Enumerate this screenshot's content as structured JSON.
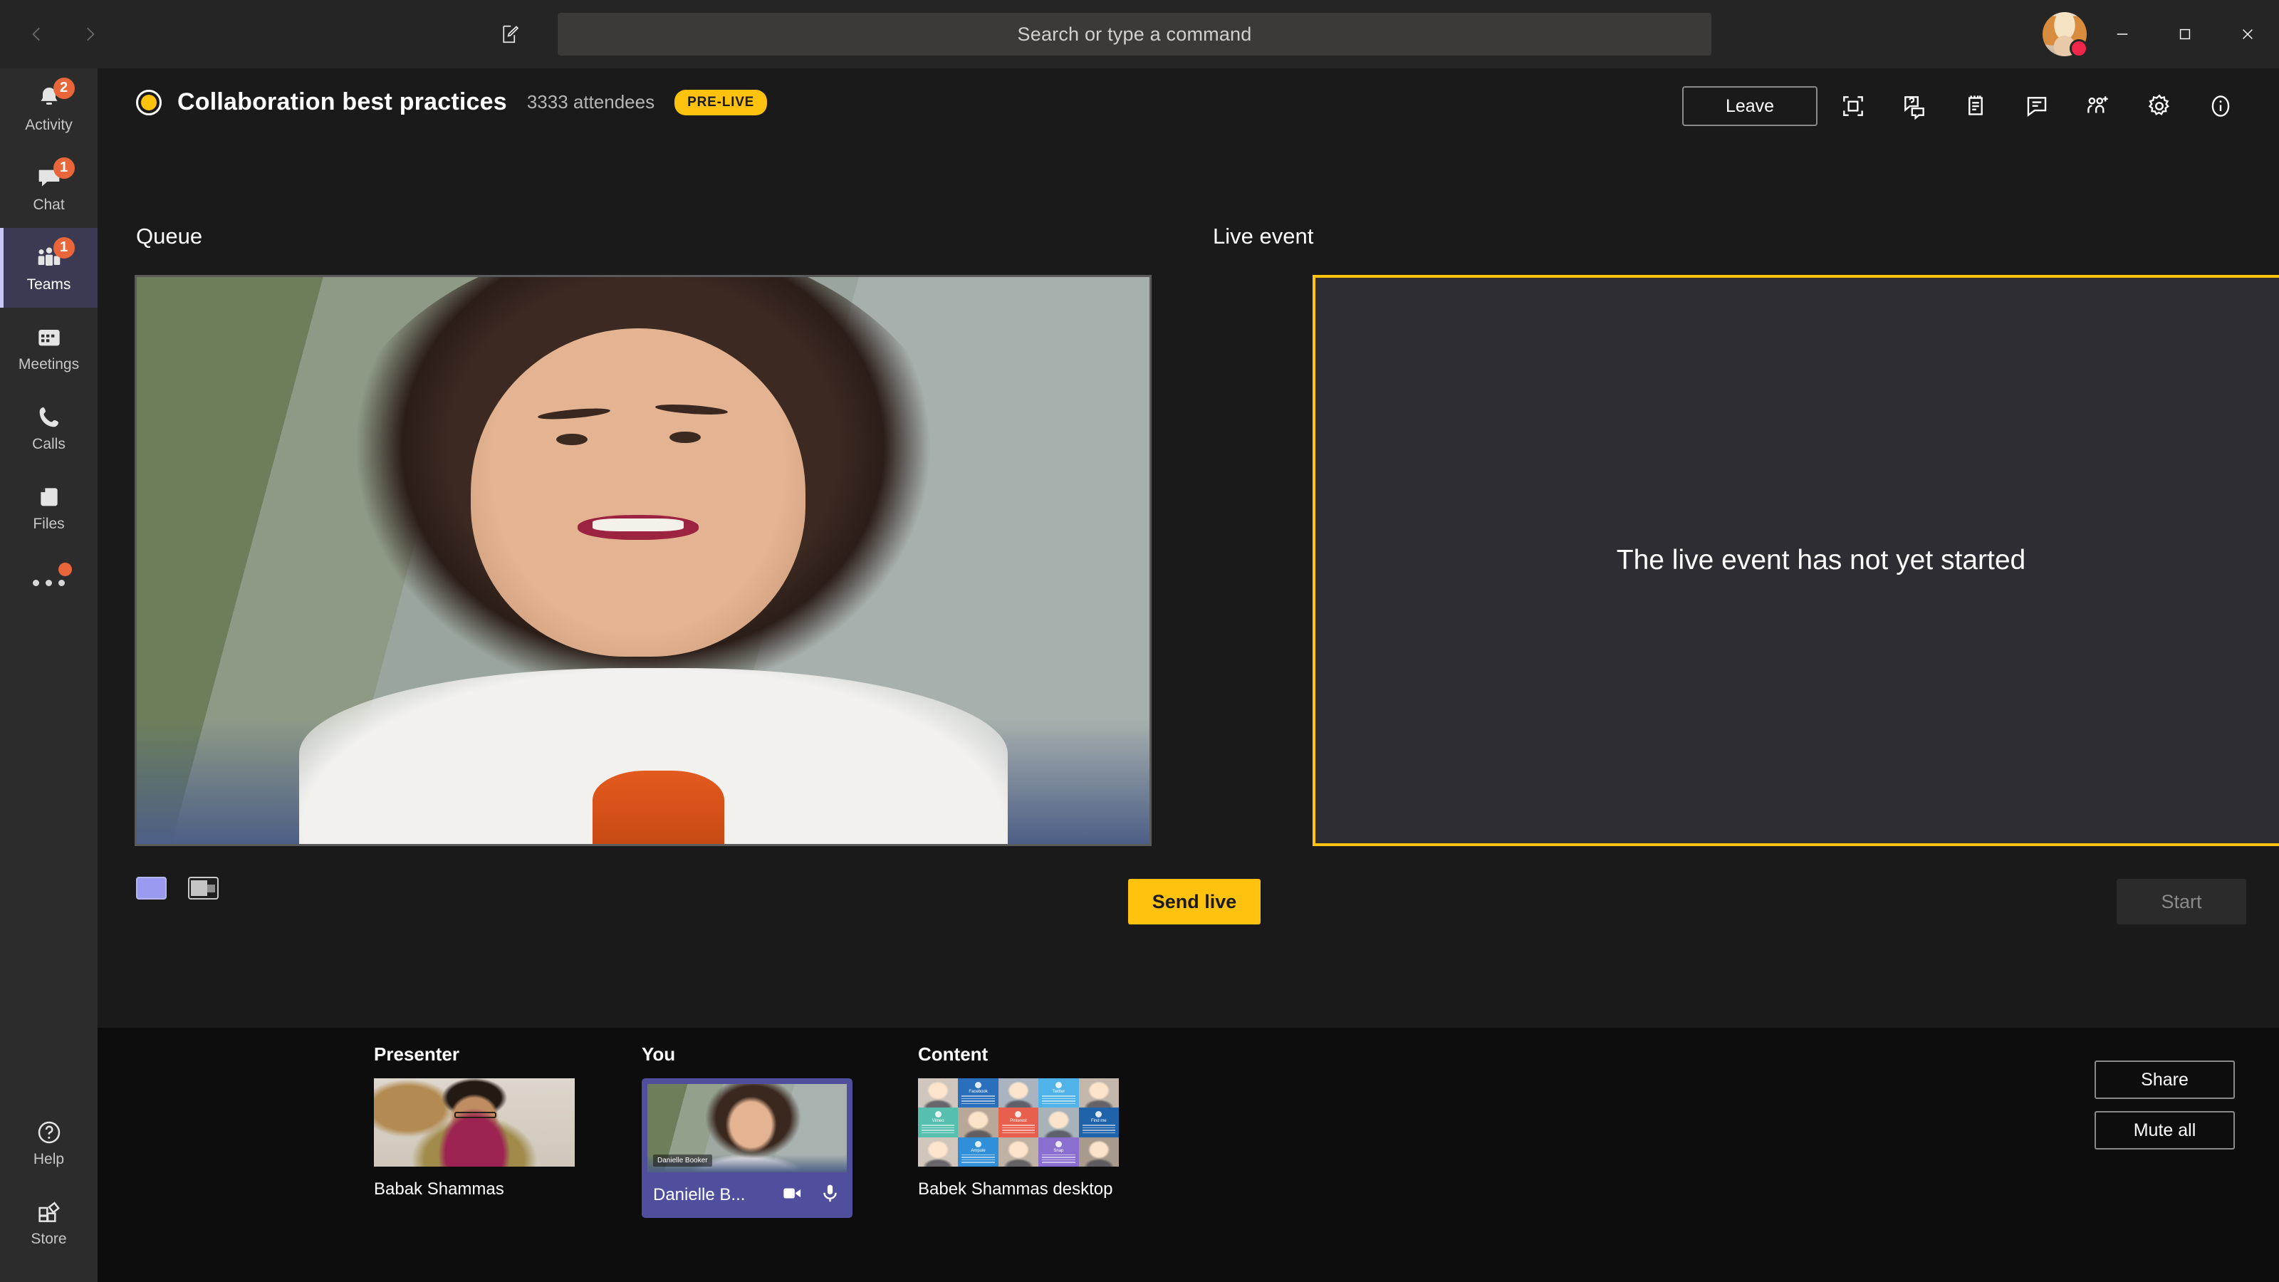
{
  "titlebar": {
    "back_icon": "chevron-left-icon",
    "forward_icon": "chevron-right-icon",
    "compose_icon": "compose-new-icon",
    "search": {
      "placeholder": "Search or type a command",
      "value": ""
    },
    "avatar_label": "User avatar",
    "presence": "do-not-disturb",
    "minimize_label": "Minimize",
    "maximize_label": "Maximize",
    "close_label": "Close"
  },
  "rail": {
    "items": [
      {
        "label": "Activity",
        "icon": "bell-icon",
        "badge": "2",
        "active": false
      },
      {
        "label": "Chat",
        "icon": "chat-icon",
        "badge": "1",
        "active": false
      },
      {
        "label": "Teams",
        "icon": "teams-icon",
        "badge": "1",
        "active": true
      },
      {
        "label": "Meetings",
        "icon": "calendar-icon",
        "badge": "",
        "active": false
      },
      {
        "label": "Calls",
        "icon": "phone-icon",
        "badge": "",
        "active": false
      },
      {
        "label": "Files",
        "icon": "files-icon",
        "badge": "",
        "active": false
      }
    ],
    "more_icon": "ellipsis-icon",
    "bottom": [
      {
        "label": "Help",
        "icon": "help-icon"
      },
      {
        "label": "Store",
        "icon": "store-icon"
      }
    ]
  },
  "event": {
    "title": "Collaboration best practices",
    "attendees": "3333 attendees",
    "status_badge": "PRE-LIVE",
    "leave_label": "Leave",
    "toolbar_icons": [
      "fullscreen-icon",
      "qna-icon",
      "notes-icon",
      "meeting-chat-icon",
      "add-participants-icon",
      "settings-gear-icon",
      "info-icon"
    ]
  },
  "queue": {
    "label": "Queue",
    "layout_single_icon": "layout-single-icon",
    "layout_pip_icon": "layout-picture-in-picture-icon",
    "send_live_label": "Send live",
    "preview_caption": "Danielle Booker"
  },
  "live": {
    "label": "Live event",
    "message": "The live event has not yet started",
    "start_label": "Start",
    "border_color": "#ffc20e"
  },
  "tray": {
    "groups": [
      {
        "heading": "Presenter",
        "name": "Babak Shammas"
      },
      {
        "heading": "You",
        "name": "Danielle B...",
        "selected": true,
        "thumb_caption": "Danielle Booker",
        "camera_icon": "camera-icon",
        "mic_icon": "microphone-icon"
      },
      {
        "heading": "Content",
        "name": "Babek Shammas desktop"
      }
    ],
    "content_tiles": [
      {
        "type": "photo",
        "tone": "#cfc6bd"
      },
      {
        "type": "card",
        "label": "Facebook",
        "color": "#2a6fbb"
      },
      {
        "type": "photo",
        "tone": "#a9b4c0"
      },
      {
        "type": "card",
        "label": "Twitter",
        "color": "#4fb2e8"
      },
      {
        "type": "photo",
        "tone": "#c3b7ab"
      },
      {
        "type": "card",
        "label": "Vimeo",
        "color": "#57bfae"
      },
      {
        "type": "photo",
        "tone": "#b9a897"
      },
      {
        "type": "card",
        "label": "Pinterest",
        "color": "#e8604d"
      },
      {
        "type": "photo",
        "tone": "#a7b3b8"
      },
      {
        "type": "card",
        "label": "Find me",
        "color": "#1f63ab"
      },
      {
        "type": "photo",
        "tone": "#d0c6bb"
      },
      {
        "type": "card",
        "label": "Ampule",
        "color": "#2f8fd8"
      },
      {
        "type": "photo",
        "tone": "#bfb2a4"
      },
      {
        "type": "card",
        "label": "Snap",
        "color": "#8a6fd0"
      },
      {
        "type": "photo",
        "tone": "#a89b8e"
      }
    ],
    "share_label": "Share",
    "mute_all_label": "Mute all"
  },
  "colors": {
    "accent_yellow": "#ffc20e",
    "teams_purple": "#4f4f9e",
    "badge_orange": "#e8663a",
    "presence_red": "#f0264a"
  }
}
